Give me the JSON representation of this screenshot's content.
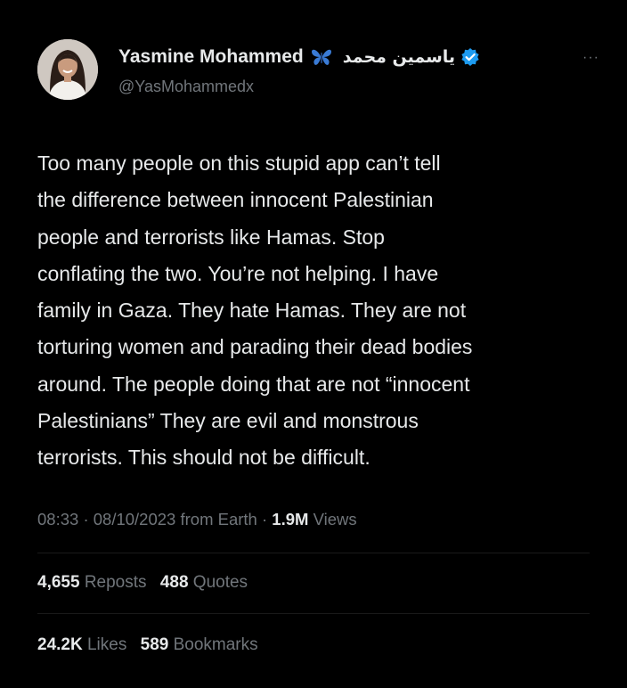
{
  "user": {
    "display_name": "Yasmine Mohammed",
    "arabic_name": "ياسمين محمد",
    "handle": "@YasMohammedx",
    "badge_icon": "butterfly-icon",
    "verified_icon": "verified-badge-icon",
    "verified_color": "#1d9bf0",
    "butterfly_color": "#3a7bd5"
  },
  "more_label": "···",
  "tweet": {
    "text": "Too many people on this stupid app can’t tell\nthe difference between innocent Palestinian\npeople and terrorists like Hamas. Stop\nconflating the two. You’re not helping. I have\nfamily in Gaza. They hate Hamas. They are not\ntorturing women and parading their dead bodies\naround. The people doing that are not “innocent\nPalestinians” They are evil and monstrous\nterrorists. This should not be difficult."
  },
  "meta": {
    "time": "08:33",
    "separator": "·",
    "date": "08/10/2023",
    "source": "from Earth",
    "views_count": "1.9M",
    "views_label": "Views"
  },
  "stats": {
    "reposts_count": "4,655",
    "reposts_label": "Reposts",
    "quotes_count": "488",
    "quotes_label": "Quotes",
    "likes_count": "24.2K",
    "likes_label": "Likes",
    "bookmarks_count": "589",
    "bookmarks_label": "Bookmarks"
  },
  "colors": {
    "background": "#000000",
    "primary_text": "#e7e9ea",
    "secondary_text": "#71767b"
  }
}
